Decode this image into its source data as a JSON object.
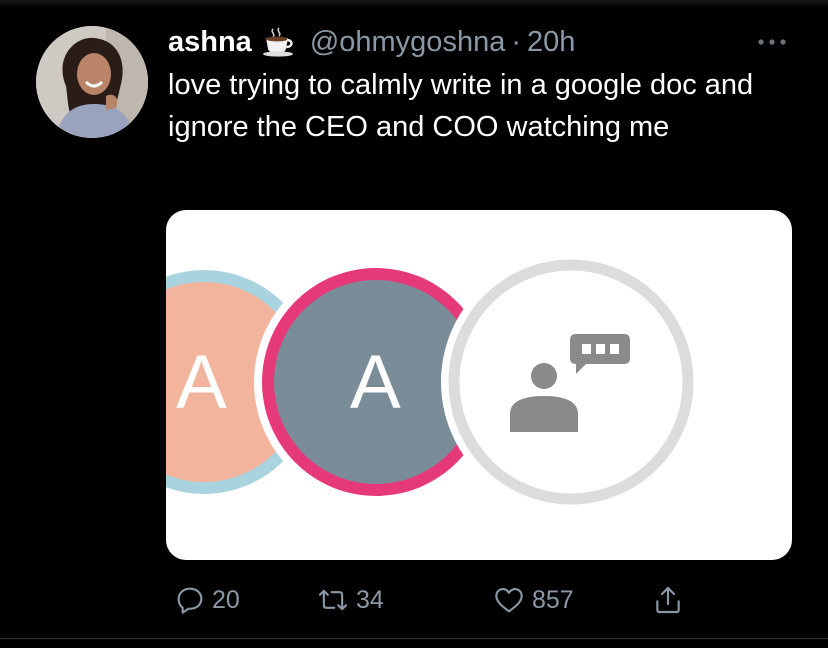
{
  "tweet": {
    "display_name": "ashna",
    "name_emoji": "coffee-cup-icon",
    "handle": "@ohmygoshna",
    "separator": "·",
    "time": "20h",
    "text": "love trying to calmly write in a google doc and ignore the CEO and COO watching me",
    "media": {
      "avatar_letters": [
        "A",
        "A"
      ],
      "colors": {
        "avatar1_fill": "#f2b49c",
        "avatar1_ring": "#a9d3df",
        "avatar2_fill": "#7b8c99",
        "avatar2_ring": "#e5397a",
        "viewer_ring": "#dcdcdf",
        "viewer_icon": "#8a8a8a"
      }
    },
    "actions": {
      "reply_count": "20",
      "retweet_count": "34",
      "like_count": "857"
    }
  },
  "colors": {
    "background": "#000000",
    "text": "#ffffff",
    "muted": "#8b98a5"
  }
}
